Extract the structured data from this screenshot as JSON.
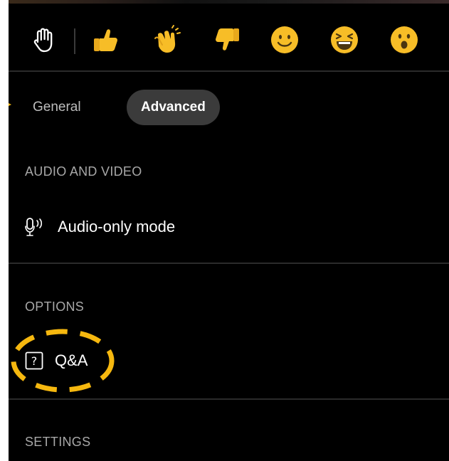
{
  "reactions": [
    {
      "name": "raise-hand"
    },
    {
      "name": "like"
    },
    {
      "name": "applause"
    },
    {
      "name": "dislike"
    },
    {
      "name": "smile"
    },
    {
      "name": "laugh"
    },
    {
      "name": "surprised"
    }
  ],
  "tabs": [
    {
      "label": "General",
      "active": false
    },
    {
      "label": "Advanced",
      "active": true
    }
  ],
  "sections": {
    "audio_video": {
      "title": "AUDIO AND VIDEO",
      "items": [
        {
          "label": "Audio-only mode",
          "icon": "audio-only-icon"
        }
      ]
    },
    "options": {
      "title": "OPTIONS",
      "items": [
        {
          "label": "Q&A",
          "icon": "question-icon"
        }
      ]
    },
    "settings": {
      "title": "SETTINGS"
    }
  },
  "colors": {
    "background": "#000000",
    "active_tab": "#3b3b3b",
    "annotation": "#f6b80f",
    "emoji_yellow": "#f7bd27"
  }
}
